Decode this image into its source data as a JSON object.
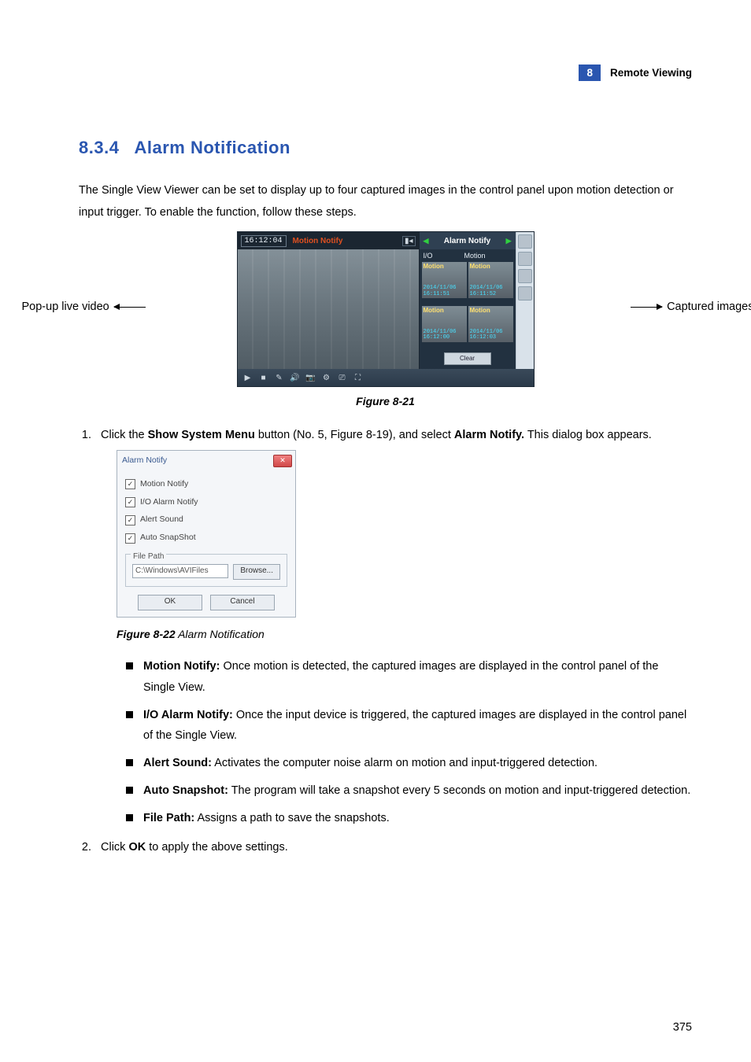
{
  "header": {
    "badge": "8",
    "text": "Remote  Viewing"
  },
  "section": {
    "number": "8.3.4",
    "title": "Alarm Notification"
  },
  "intro": "The Single View Viewer can be set to display up to four captured images in the control panel upon motion detection or input trigger. To enable the function, follow these steps.",
  "annotations": {
    "left": "Pop-up live video",
    "right": "Captured images"
  },
  "viewer": {
    "time": "16:12:04",
    "motion": "Motion Notify",
    "alarm_title": "Alarm Notify",
    "io": "I/O",
    "motion_col": "Motion",
    "clear": "Clear",
    "thumbs": [
      {
        "tag": "Motion",
        "ts": "2014/11/06\n16:11:51"
      },
      {
        "tag": "Motion",
        "ts": "2014/11/06\n16:11:52"
      },
      {
        "tag": "Motion",
        "ts": "2014/11/06\n16:12:00"
      },
      {
        "tag": "Motion",
        "ts": "2014/11/06\n16:12:03"
      }
    ]
  },
  "figure1": "Figure 8-21",
  "step1": {
    "pre": "Click the ",
    "b1": "Show System Menu",
    "mid": " button (No. 5, Figure 8-19), and select ",
    "b2": "Alarm Notify.",
    "post": " This dialog box appears."
  },
  "dialog": {
    "title": "Alarm Notify",
    "opts": [
      "Motion Notify",
      "I/O Alarm Notify",
      "Alert Sound",
      "Auto SnapShot"
    ],
    "group": "File Path",
    "path": "C:\\Windows\\AVIFiles",
    "browse": "Browse...",
    "ok": "OK",
    "cancel": "Cancel"
  },
  "figure2": {
    "bold": "Figure 8-22",
    "rest": " Alarm Notification"
  },
  "bullets": [
    {
      "b": "Motion Notify:",
      "t": " Once motion is detected, the captured images are displayed in the control panel of the Single View."
    },
    {
      "b": "I/O Alarm Notify:",
      "t": " Once the input device is triggered, the captured images are displayed in the control panel of the Single View."
    },
    {
      "b": "Alert Sound:",
      "t": " Activates the computer noise alarm on motion and input-triggered detection."
    },
    {
      "b": "Auto Snapshot:",
      "t": " The program will take a snapshot every 5 seconds on motion and input-triggered detection."
    },
    {
      "b": "File Path:",
      "t": " Assigns a path to save the snapshots."
    }
  ],
  "step2": {
    "pre": "Click ",
    "b": "OK",
    "post": " to apply the above settings."
  },
  "page_number": "375"
}
